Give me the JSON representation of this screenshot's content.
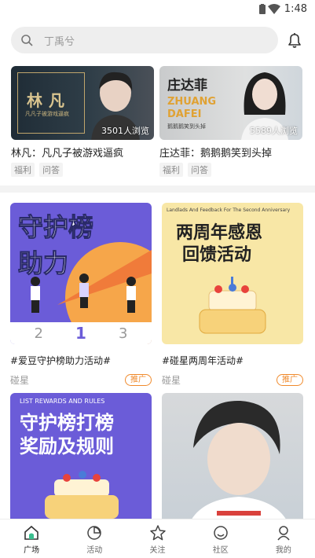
{
  "status": {
    "time": "1:48"
  },
  "search": {
    "placeholder": "丁禹兮"
  },
  "top_cards": [
    {
      "name_art": "林凡",
      "subtitle_art": "凡凡子被游戏逼疯",
      "views": "3501人浏览",
      "title": "林凡：凡凡子被游戏逼疯",
      "tags": [
        "福利",
        "问答"
      ]
    },
    {
      "name_art": "庄达菲",
      "pinyin_art_1": "ZHUANG",
      "pinyin_art_2": "DAFEI",
      "subtitle_art": "鹅鹅鹅笑到头掉",
      "views": "5589人浏览",
      "title": "庄达菲：鹅鹅鹅笑到头掉",
      "tags": [
        "福利",
        "问答"
      ]
    }
  ],
  "grid": [
    {
      "art_line1": "守护榜",
      "art_line2": "助力",
      "podium": [
        "2",
        "1",
        "3"
      ],
      "title": "#爱豆守护榜助力活动#",
      "source": "碰星",
      "badge": "推广"
    },
    {
      "art_top": "Landlads And Feedback For The Second Anniversary",
      "art_line1": "两周年感恩",
      "art_line2": "回馈活动",
      "title": "#碰星两周年活动#",
      "source": "碰星",
      "badge": "推广"
    },
    {
      "art_top": "LIST REWARDS AND RULES",
      "art_line1": "守护榜打榜",
      "art_line2": "奖励及规则"
    },
    {}
  ],
  "tabbar": [
    {
      "label": "广场",
      "icon": "home-icon",
      "active": true
    },
    {
      "label": "活动",
      "icon": "activity-icon",
      "active": false
    },
    {
      "label": "关注",
      "icon": "star-icon",
      "active": false
    },
    {
      "label": "社区",
      "icon": "community-icon",
      "active": false
    },
    {
      "label": "我的",
      "icon": "profile-icon",
      "active": false
    }
  ],
  "colors": {
    "accent": "#f08a2c",
    "card_purple": "#6b5cd8",
    "card_yellow": "#f8e7a6"
  }
}
